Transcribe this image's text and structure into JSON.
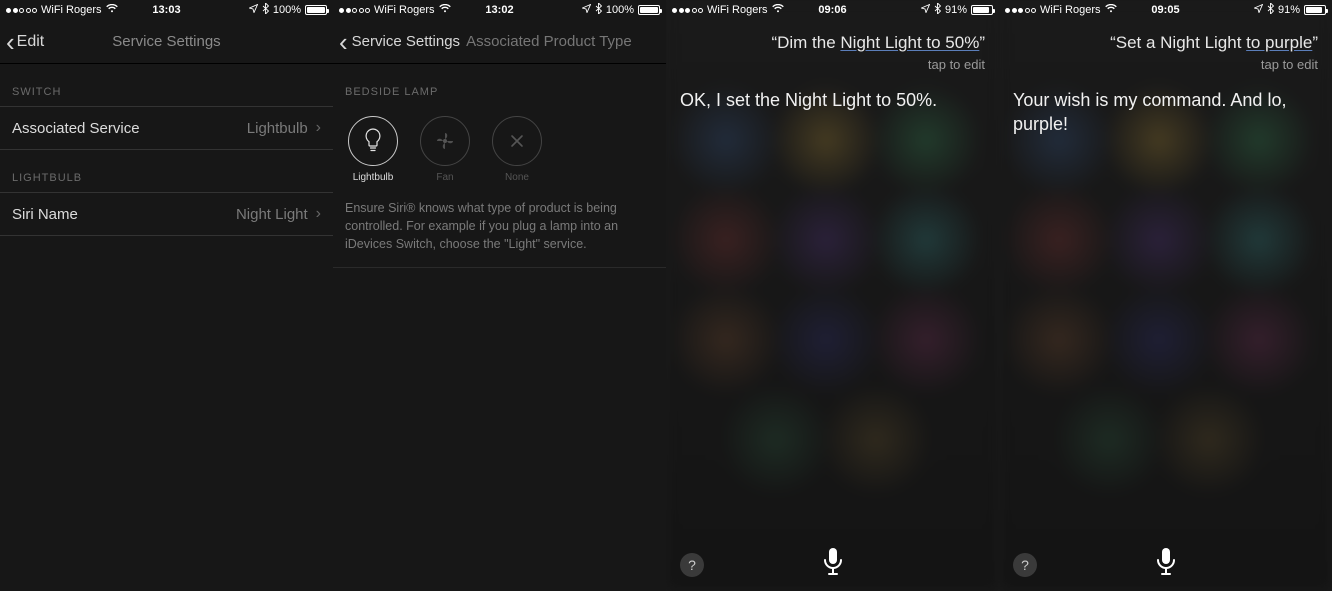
{
  "screens": [
    {
      "status": {
        "carrier": "WiFi Rogers",
        "time": "13:03",
        "battery_pct": "100%",
        "battery_fill": 100,
        "signal_dots": 2
      },
      "nav": {
        "back": "Edit",
        "title": "Service Settings"
      },
      "sections": [
        {
          "header": "SWITCH",
          "rows": [
            {
              "label": "Associated Service",
              "value": "Lightbulb"
            }
          ]
        },
        {
          "header": "LIGHTBULB",
          "rows": [
            {
              "label": "Siri Name",
              "value": "Night Light"
            }
          ]
        }
      ]
    },
    {
      "status": {
        "carrier": "WiFi Rogers",
        "time": "13:02",
        "battery_pct": "100%",
        "battery_fill": 100,
        "signal_dots": 2
      },
      "nav": {
        "back": "Service Settings",
        "subtitle": "Associated Product Type"
      },
      "section_header": "BEDSIDE LAMP",
      "products": [
        {
          "name": "Lightbulb",
          "selected": true
        },
        {
          "name": "Fan",
          "selected": false
        },
        {
          "name": "None",
          "selected": false
        }
      ],
      "help": "Ensure Siri® knows what type of product is being controlled.  For example if you plug a lamp into an iDevices Switch, choose the \"Light\" service."
    },
    {
      "status": {
        "carrier": "WiFi Rogers",
        "time": "09:06",
        "battery_pct": "91%",
        "battery_fill": 91,
        "signal_dots": 3
      },
      "query_pre": "“Dim the ",
      "query_ul": "Night Light to 50%",
      "query_post": "”",
      "edit_hint": "tap to edit",
      "response": "OK, I set the Night Light to 50%."
    },
    {
      "status": {
        "carrier": "WiFi Rogers",
        "time": "09:05",
        "battery_pct": "91%",
        "battery_fill": 91,
        "signal_dots": 3
      },
      "query_pre": "“Set a Night Light ",
      "query_ul": "to purple",
      "query_post": "”",
      "edit_hint": "tap to edit",
      "response": "Your wish is my command. And lo, purple!"
    }
  ]
}
